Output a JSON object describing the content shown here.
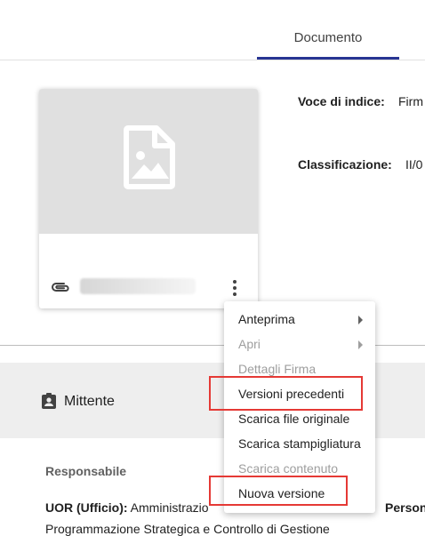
{
  "tabs": [
    {
      "label": "Documento"
    }
  ],
  "document": {
    "filename": ""
  },
  "metadata": {
    "voce_label": "Voce di indice:",
    "voce_value": "Firm",
    "classificazione_label": "Classificazione:",
    "classificazione_value": "II/0"
  },
  "section": {
    "mittente_label": "Mittente"
  },
  "details": {
    "responsabile_label": "Responsabile",
    "uor_label": "UOR (Ufficio):",
    "uor_value": "Amministrazio",
    "persona_label": "Person",
    "programmazione_value": "Programmazione Strategica e Controllo di Gestione"
  },
  "context_menu": {
    "items": [
      {
        "label": "Anteprima",
        "disabled": false,
        "submenu": true
      },
      {
        "label": "Apri",
        "disabled": true,
        "submenu": true
      },
      {
        "label": "Dettagli Firma",
        "disabled": true,
        "submenu": false
      },
      {
        "label": "Versioni precedenti",
        "disabled": false,
        "submenu": false
      },
      {
        "label": "Scarica file originale",
        "disabled": false,
        "submenu": false
      },
      {
        "label": "Scarica stampigliatura",
        "disabled": false,
        "submenu": false
      },
      {
        "label": "Scarica contenuto",
        "disabled": true,
        "submenu": false
      },
      {
        "label": "Nuova versione",
        "disabled": false,
        "submenu": false
      }
    ]
  },
  "colors": {
    "accent": "#283593",
    "highlight": "#e53935",
    "disabled_text": "#9e9e9e",
    "section_bg": "#eeeeee"
  }
}
